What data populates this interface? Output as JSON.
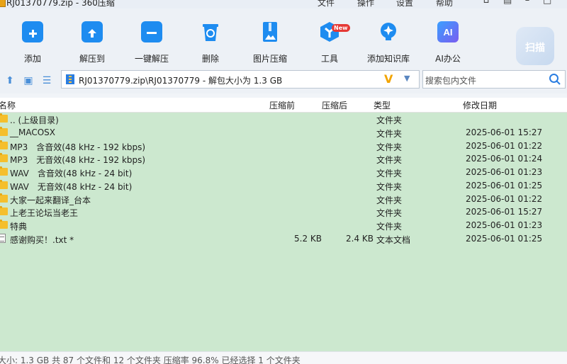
{
  "window": {
    "title": "RJ01370779.zip - 360压缩",
    "menus": [
      "文件",
      "操作",
      "设置",
      "帮助"
    ]
  },
  "toolbar": {
    "items": [
      {
        "label": "添加",
        "icon": "add-icon"
      },
      {
        "label": "解压到",
        "icon": "extract-to-icon"
      },
      {
        "label": "一键解压",
        "icon": "one-click-extract-icon"
      },
      {
        "label": "删除",
        "icon": "delete-icon"
      },
      {
        "label": "图片压缩",
        "icon": "image-compress-icon"
      },
      {
        "label": "工具",
        "icon": "tools-icon"
      },
      {
        "label": "添加知识库",
        "icon": "knowledge-base-icon"
      },
      {
        "label": "AI办公",
        "icon": "ai-office-icon"
      }
    ],
    "new_badge": "New",
    "scan_label": "扫描",
    "colors": {
      "accent": "#1e8cf0",
      "badge": "#e53935",
      "ai": "#5b5cf0"
    }
  },
  "address": {
    "path": "RJ01370779.zip\\RJ01370779 - 解包大小为 1.3 GB",
    "search_placeholder": "搜索包内文件"
  },
  "columns": {
    "name": "名称",
    "compressed_before": "压缩前",
    "compressed_after": "压缩后",
    "type": "类型",
    "modified": "修改日期"
  },
  "files": [
    {
      "name": ".. (上级目录)",
      "before": "",
      "after": "",
      "type": "文件夹",
      "date": "",
      "kind": "folder"
    },
    {
      "name": "__MACOSX",
      "before": "",
      "after": "",
      "type": "文件夹",
      "date": "2025-06-01 15:27",
      "kind": "folder"
    },
    {
      "name": "MP3　含音效(48 kHz - 192 kbps)",
      "before": "",
      "after": "",
      "type": "文件夹",
      "date": "2025-06-01 01:22",
      "kind": "folder"
    },
    {
      "name": "MP3　无音效(48 kHz - 192 kbps)",
      "before": "",
      "after": "",
      "type": "文件夹",
      "date": "2025-06-01 01:24",
      "kind": "folder"
    },
    {
      "name": "WAV　含音效(48 kHz - 24 bit)",
      "before": "",
      "after": "",
      "type": "文件夹",
      "date": "2025-06-01 01:23",
      "kind": "folder"
    },
    {
      "name": "WAV　无音效(48 kHz - 24 bit)",
      "before": "",
      "after": "",
      "type": "文件夹",
      "date": "2025-06-01 01:25",
      "kind": "folder"
    },
    {
      "name": "大家一起来翻译_台本",
      "before": "",
      "after": "",
      "type": "文件夹",
      "date": "2025-06-01 01:22",
      "kind": "folder"
    },
    {
      "name": "上老王论坛当老王",
      "before": "",
      "after": "",
      "type": "文件夹",
      "date": "2025-06-01 15:27",
      "kind": "folder"
    },
    {
      "name": "特典",
      "before": "",
      "after": "",
      "type": "文件夹",
      "date": "2025-06-01 01:23",
      "kind": "folder"
    },
    {
      "name": "感谢购买！.txt *",
      "before": "5.2 KB",
      "after": "2.4 KB",
      "type": "文本文档",
      "date": "2025-06-01 01:25",
      "kind": "file"
    }
  ],
  "status": "大小: 1.3 GB 共 87 个文件和 12 个文件夹 压缩率 96.8% 已经选择 1 个文件夹"
}
